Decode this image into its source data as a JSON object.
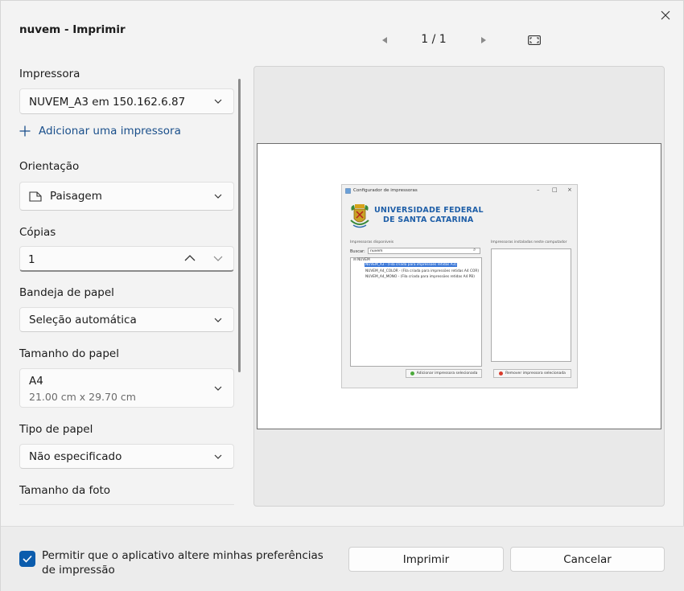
{
  "window": {
    "title": "nuvem - Imprimir"
  },
  "nav": {
    "page_indicator": "1 / 1"
  },
  "settings": {
    "printer": {
      "label": "Impressora",
      "value": "NUVEM_A3 em 150.162.6.87"
    },
    "add_printer": "Adicionar uma impressora",
    "orientation": {
      "label": "Orientação",
      "value": "Paisagem"
    },
    "copies": {
      "label": "Cópias",
      "value": "1"
    },
    "paper_tray": {
      "label": "Bandeja de papel",
      "value": "Seleção automática"
    },
    "paper_size": {
      "label": "Tamanho do papel",
      "value": "A4",
      "detail": "21.00 cm x 29.70 cm"
    },
    "paper_type": {
      "label": "Tipo de papel",
      "value": "Não especificado"
    },
    "photo_size": {
      "label": "Tamanho da foto"
    }
  },
  "preview": {
    "window_title": "Configurador de impressoras",
    "university_line1": "UNIVERSIDADE FEDERAL",
    "university_line2": "DE SANTA CATARINA",
    "available_label": "Impressoras disponíveis",
    "installed_label": "Impressoras instaladas neste computador",
    "search_label": "Buscar:",
    "search_value": "nuvem",
    "tree_root": "NUVEM",
    "tree_items": [
      "NUVEM_A3 - (Fila criada para impressões retidas A3)",
      "NUVEM_A4_COLOR - (Fila criada para impressões retidas A4 COR)",
      "NUVEM_A4_MONO - (Fila criada para impressões retidas A4 PB)"
    ],
    "add_button": "Adicionar impressora selecionada",
    "remove_button": "Remover impressora selecionada"
  },
  "footer": {
    "checkbox_label": "Permitir que o aplicativo altere minhas preferências de impressão",
    "checkbox_checked": true,
    "print_button": "Imprimir",
    "cancel_button": "Cancelar"
  },
  "colors": {
    "accent": "#0b5cad",
    "link": "#1a4f8b",
    "ufsc_blue": "#1f5fa8"
  }
}
